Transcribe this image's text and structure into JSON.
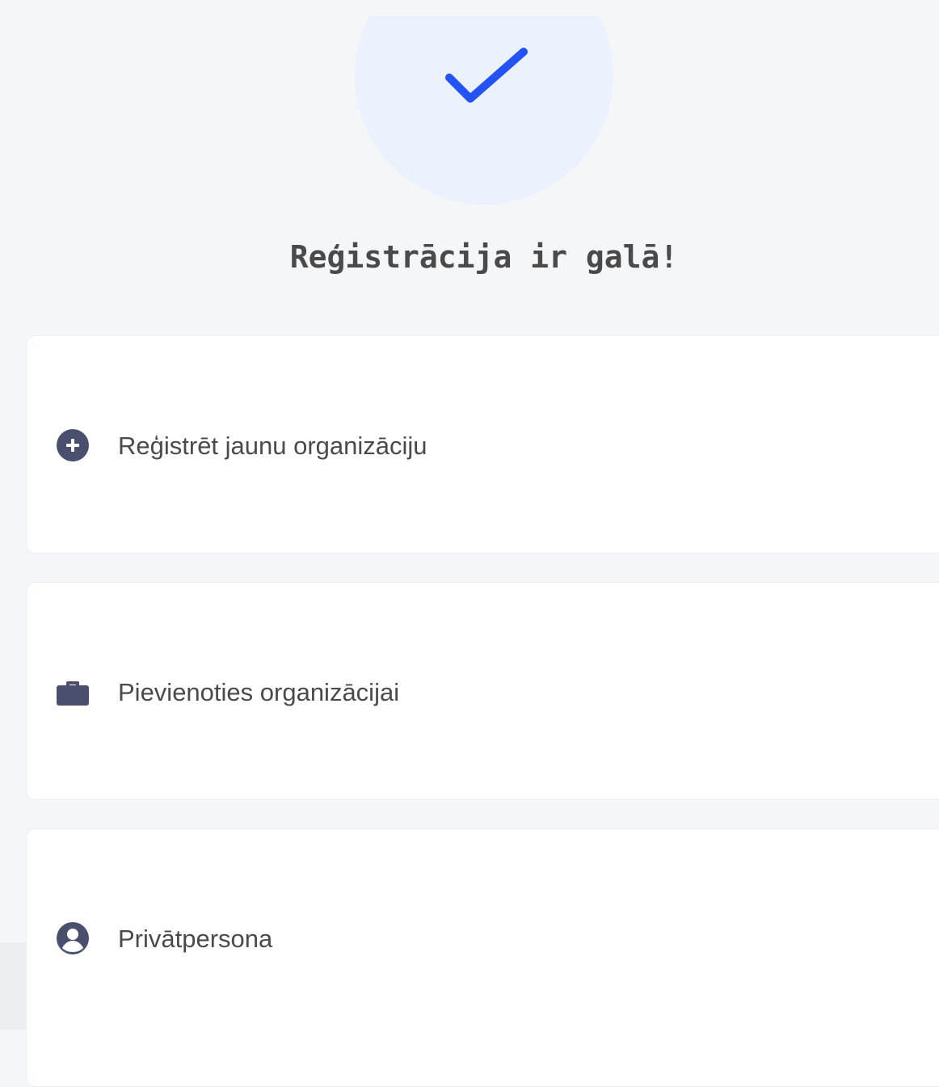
{
  "success": {
    "title": "Reģistrācija ir galā!",
    "icon": "checkmark-icon",
    "accent_color": "#2352f5",
    "circle_color": "#ebf1fd"
  },
  "options": [
    {
      "label": "Reģistrēt jaunu organizāciju",
      "icon": "plus-circle-icon"
    },
    {
      "label": "Pievienoties organizācijai",
      "icon": "briefcase-icon"
    },
    {
      "label": "Privātpersona",
      "icon": "user-circle-icon"
    }
  ],
  "colors": {
    "background": "#f5f6f8",
    "card": "#ffffff",
    "icon": "#4a4f6d",
    "text": "#4a4a4a"
  }
}
